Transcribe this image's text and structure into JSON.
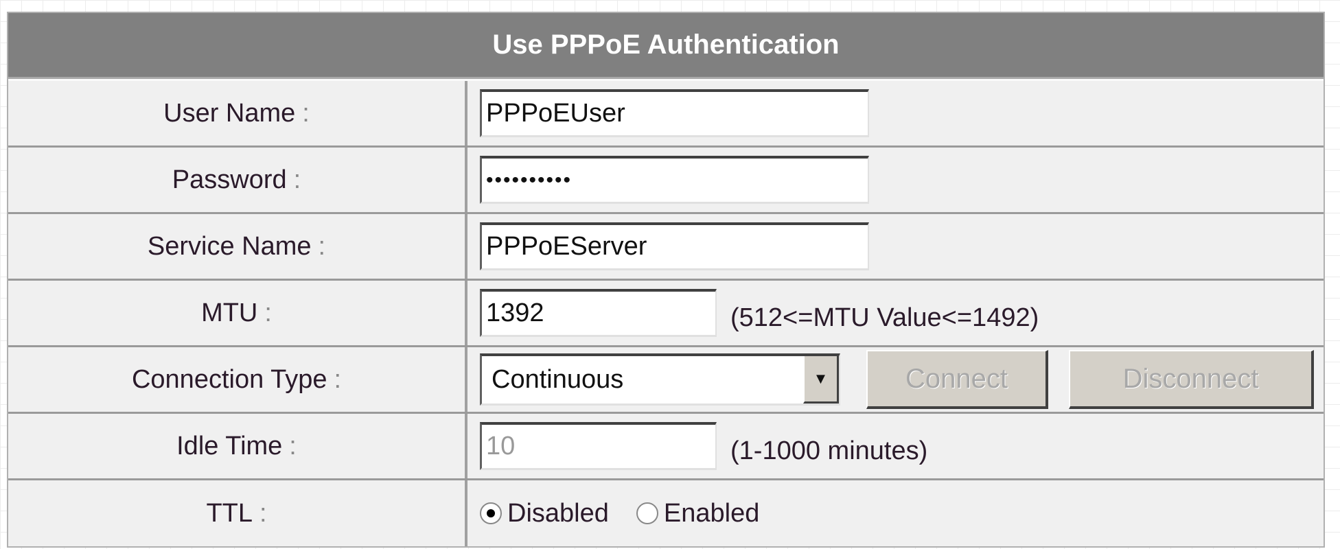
{
  "title": "Use PPPoE Authentication",
  "rows": {
    "user_name": {
      "label": "User Name",
      "value": "PPPoEUser"
    },
    "password": {
      "label": "Password",
      "value": "••••••••••"
    },
    "service_name": {
      "label": "Service Name",
      "value": "PPPoEServer"
    },
    "mtu": {
      "label": "MTU",
      "value": "1392",
      "hint": "(512<=MTU Value<=1492)"
    },
    "connection_type": {
      "label": "Connection Type",
      "value": "Continuous",
      "connect": "Connect",
      "disconnect": "Disconnect"
    },
    "idle_time": {
      "label": "Idle Time",
      "value": "10",
      "hint": "(1-1000 minutes)"
    },
    "ttl": {
      "label": "TTL",
      "options": [
        "Disabled",
        "Enabled"
      ],
      "selected": "Disabled"
    }
  },
  "colon": ":"
}
